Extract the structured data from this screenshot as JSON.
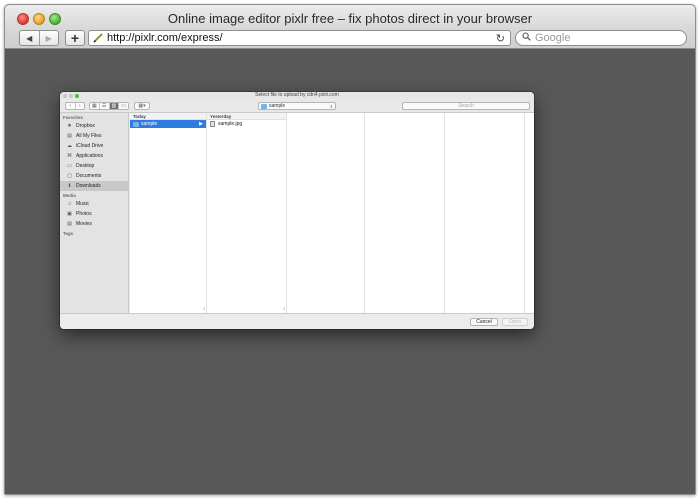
{
  "browser": {
    "title": "Online image editor pixlr free – fix photos direct in your browser",
    "url": "http://pixlr.com/express/",
    "search_placeholder": "Google",
    "nav_back": "◀",
    "nav_forward": "▶",
    "new_tab": "+",
    "reload": "↻",
    "search_glyph": "🔍",
    "icons": [
      "back-arrow-icon",
      "forward-arrow-icon",
      "plus-icon",
      "pencil-favicon-icon",
      "reload-icon",
      "search-icon"
    ]
  },
  "dialog": {
    "title": "Select file to upload by cdn4.pixlr.com",
    "path_popup": "sample",
    "search_placeholder": "Search",
    "toolbar": {
      "back": "‹",
      "forward": "›",
      "view_icon": "▦",
      "view_list": "☰",
      "view_columns": "▥",
      "view_cover": "▭",
      "arrange": "▦▾"
    },
    "sidebar": {
      "favorites_header": "Favorites",
      "favorites": [
        {
          "label": "Dropbox",
          "icon": "dropbox-icon",
          "glyph": "❖"
        },
        {
          "label": "All My Files",
          "icon": "all-files-icon",
          "glyph": "▤"
        },
        {
          "label": "iCloud Drive",
          "icon": "cloud-icon",
          "glyph": "☁"
        },
        {
          "label": "Applications",
          "icon": "applications-icon",
          "glyph": "⌘"
        },
        {
          "label": "Desktop",
          "icon": "desktop-icon",
          "glyph": "▭"
        },
        {
          "label": "Documents",
          "icon": "documents-icon",
          "glyph": "▢"
        },
        {
          "label": "Downloads",
          "icon": "downloads-icon",
          "glyph": "⬇",
          "selected": true
        }
      ],
      "media_header": "Media",
      "media": [
        {
          "label": "Music",
          "icon": "music-icon",
          "glyph": "♫"
        },
        {
          "label": "Photos",
          "icon": "photos-icon",
          "glyph": "▣"
        },
        {
          "label": "Movies",
          "icon": "movies-icon",
          "glyph": "▤"
        }
      ],
      "tags_header": "Tags"
    },
    "columns": [
      {
        "header": "Today",
        "rows": [
          {
            "label": "sample",
            "type": "folder",
            "selected": true,
            "chevron": "▶"
          }
        ]
      },
      {
        "header": "Yesterday",
        "rows": [
          {
            "label": "sample.jpg",
            "type": "file"
          }
        ]
      }
    ],
    "buttons": {
      "cancel": "Cancel",
      "open": "Open"
    }
  },
  "colors": {
    "page_background": "#585858",
    "selection_blue": "#2f7ce0",
    "folder_blue": "#6fb6ee"
  }
}
